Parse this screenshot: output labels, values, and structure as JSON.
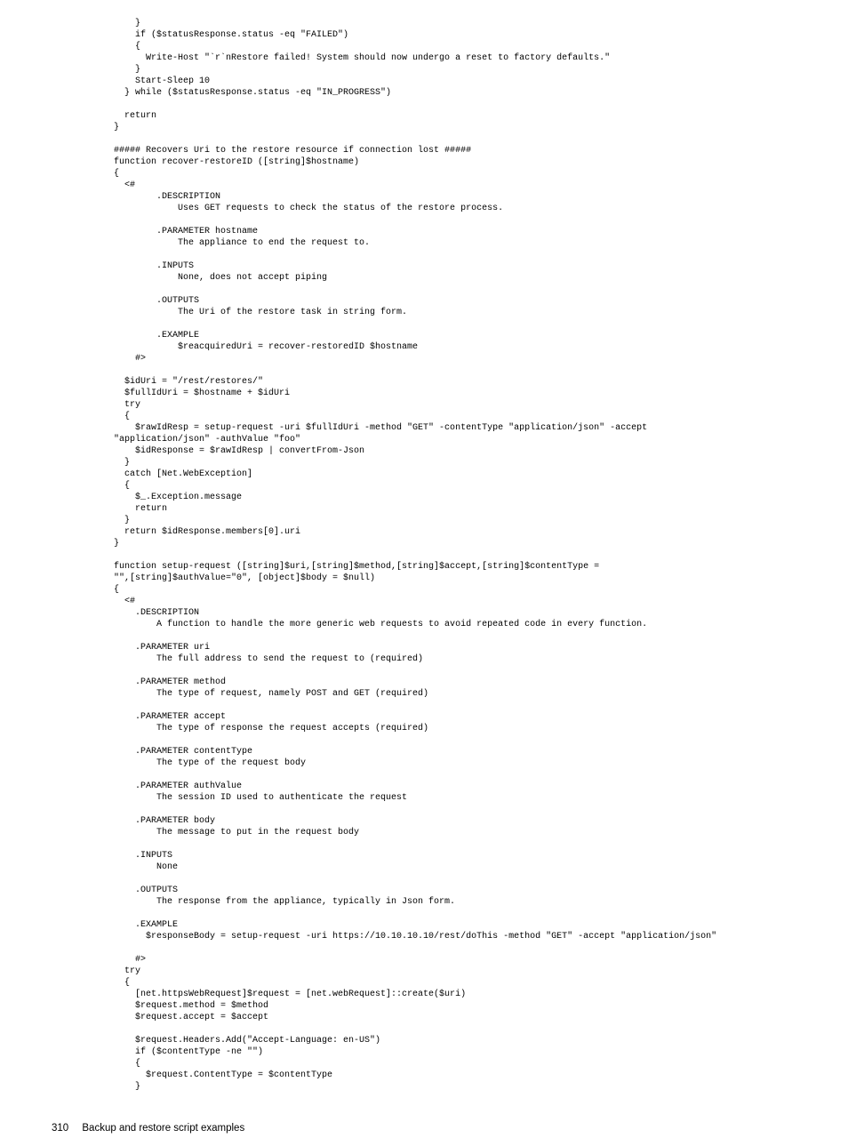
{
  "code": "    }\n    if ($statusResponse.status -eq \"FAILED\")\n    {\n      Write-Host \"`r`nRestore failed! System should now undergo a reset to factory defaults.\"\n    }\n    Start-Sleep 10\n  } while ($statusResponse.status -eq \"IN_PROGRESS\")\n\n  return\n}\n\n##### Recovers Uri to the restore resource if connection lost #####\nfunction recover-restoreID ([string]$hostname)\n{\n  <#\n        .DESCRIPTION\n            Uses GET requests to check the status of the restore process.\n\n        .PARAMETER hostname\n            The appliance to end the request to.\n\n        .INPUTS\n            None, does not accept piping\n\n        .OUTPUTS\n            The Uri of the restore task in string form.\n\n        .EXAMPLE\n            $reacquiredUri = recover-restoredID $hostname\n    #>\n\n  $idUri = \"/rest/restores/\"\n  $fullIdUri = $hostname + $idUri\n  try\n  {\n    $rawIdResp = setup-request -uri $fullIdUri -method \"GET\" -contentType \"application/json\" -accept \n\"application/json\" -authValue \"foo\"\n    $idResponse = $rawIdResp | convertFrom-Json\n  }\n  catch [Net.WebException]\n  {\n    $_.Exception.message\n    return\n  }\n  return $idResponse.members[0].uri\n}\n\nfunction setup-request ([string]$uri,[string]$method,[string]$accept,[string]$contentType = \n\"\",[string]$authValue=\"0\", [object]$body = $null)\n{\n  <#\n    .DESCRIPTION\n        A function to handle the more generic web requests to avoid repeated code in every function.\n\n    .PARAMETER uri\n        The full address to send the request to (required)\n\n    .PARAMETER method\n        The type of request, namely POST and GET (required)\n\n    .PARAMETER accept\n        The type of response the request accepts (required)\n\n    .PARAMETER contentType\n        The type of the request body\n\n    .PARAMETER authValue\n        The session ID used to authenticate the request\n\n    .PARAMETER body\n        The message to put in the request body\n\n    .INPUTS\n        None\n\n    .OUTPUTS\n        The response from the appliance, typically in Json form.\n\n    .EXAMPLE\n      $responseBody = setup-request -uri https://10.10.10.10/rest/doThis -method \"GET\" -accept \"application/json\"\n\n    #>\n  try\n  {    \n    [net.httpsWebRequest]$request = [net.webRequest]::create($uri)\n    $request.method = $method\n    $request.accept = $accept\n    \n    $request.Headers.Add(\"Accept-Language: en-US\")         \n    if ($contentType -ne \"\")\n    {\n      $request.ContentType = $contentType\n    }",
  "footer": {
    "page_number": "310",
    "section_title": "Backup and restore script examples"
  }
}
